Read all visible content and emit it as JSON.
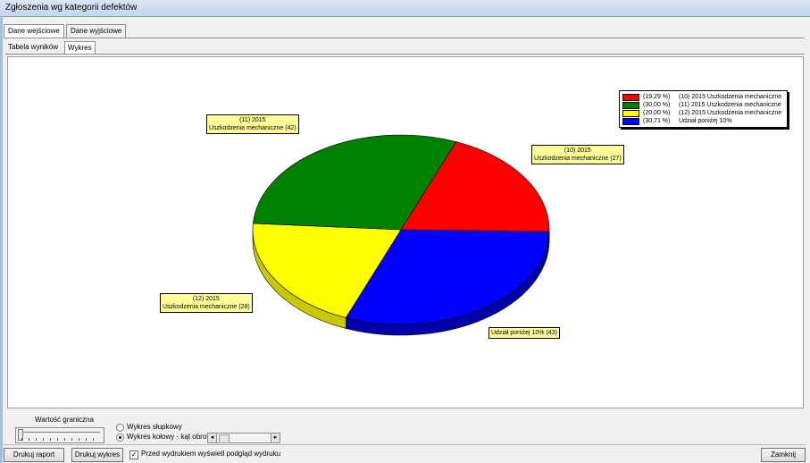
{
  "window": {
    "title": "Zgłoszenia wg kategorii defektów"
  },
  "tabs_top": [
    "Dane wejściowe",
    "Dane wyjściowe"
  ],
  "tabs_sub": [
    "Tabela wyników",
    "Wykres"
  ],
  "chart_data": {
    "type": "pie",
    "slices": [
      {
        "label": "(10) 2015 Uszkodzenia mechaniczne",
        "percent": 19.29,
        "count": 27,
        "color": "#ff0000"
      },
      {
        "label": "(11) 2015 Uszkodzenia mechaniczne",
        "percent": 30.0,
        "count": 42,
        "color": "#008000"
      },
      {
        "label": "(12) 2015 Uszkodzenia mechaniczne",
        "percent": 20.0,
        "count": 28,
        "color": "#ffff00"
      },
      {
        "label": "Udział poniżej 10%",
        "percent": 30.71,
        "count": 43,
        "color": "#0000ff"
      }
    ],
    "legend": {
      "placement": "top-right",
      "entries": [
        {
          "pct": "(19,29 %)",
          "label": "(10) 2015 Uszkodzenia mechaniczne",
          "color": "#ff0000"
        },
        {
          "pct": "(30,00 %)",
          "label": "(11) 2015 Uszkodzenia mechaniczne",
          "color": "#008000"
        },
        {
          "pct": "(20,00 %)",
          "label": "(12) 2015 Uszkodzenia mechaniczne",
          "color": "#ffff00"
        },
        {
          "pct": "(30,71 %)",
          "label": "Udział poniżej 10%",
          "color": "#0000ff"
        }
      ]
    },
    "callouts": [
      {
        "line1": "(10) 2015",
        "line2": "Uszkodzenia mechaniczne (27)"
      },
      {
        "line1": "(11) 2015",
        "line2": "Uszkodzenia mechaniczne (42)"
      },
      {
        "line1": "(12) 2015",
        "line2": "Uszkodzenia mechaniczne (28)"
      },
      {
        "line1": "Udział poniżej 10% (43)",
        "line2": ""
      }
    ]
  },
  "controls": {
    "threshold_label": "Wartość graniczna",
    "radio_bar": "Wykres słupkowy",
    "radio_pie": "Wykres kołowy - kąt obrotu:",
    "radio_selected": "pie"
  },
  "footer": {
    "print_report": "Drukuj raport",
    "print_chart": "Drukuj wykres",
    "preview_checkbox": "Przed wydrukiem wyświetl podgląd wydruku",
    "preview_checked": true,
    "close": "Zamknij"
  }
}
